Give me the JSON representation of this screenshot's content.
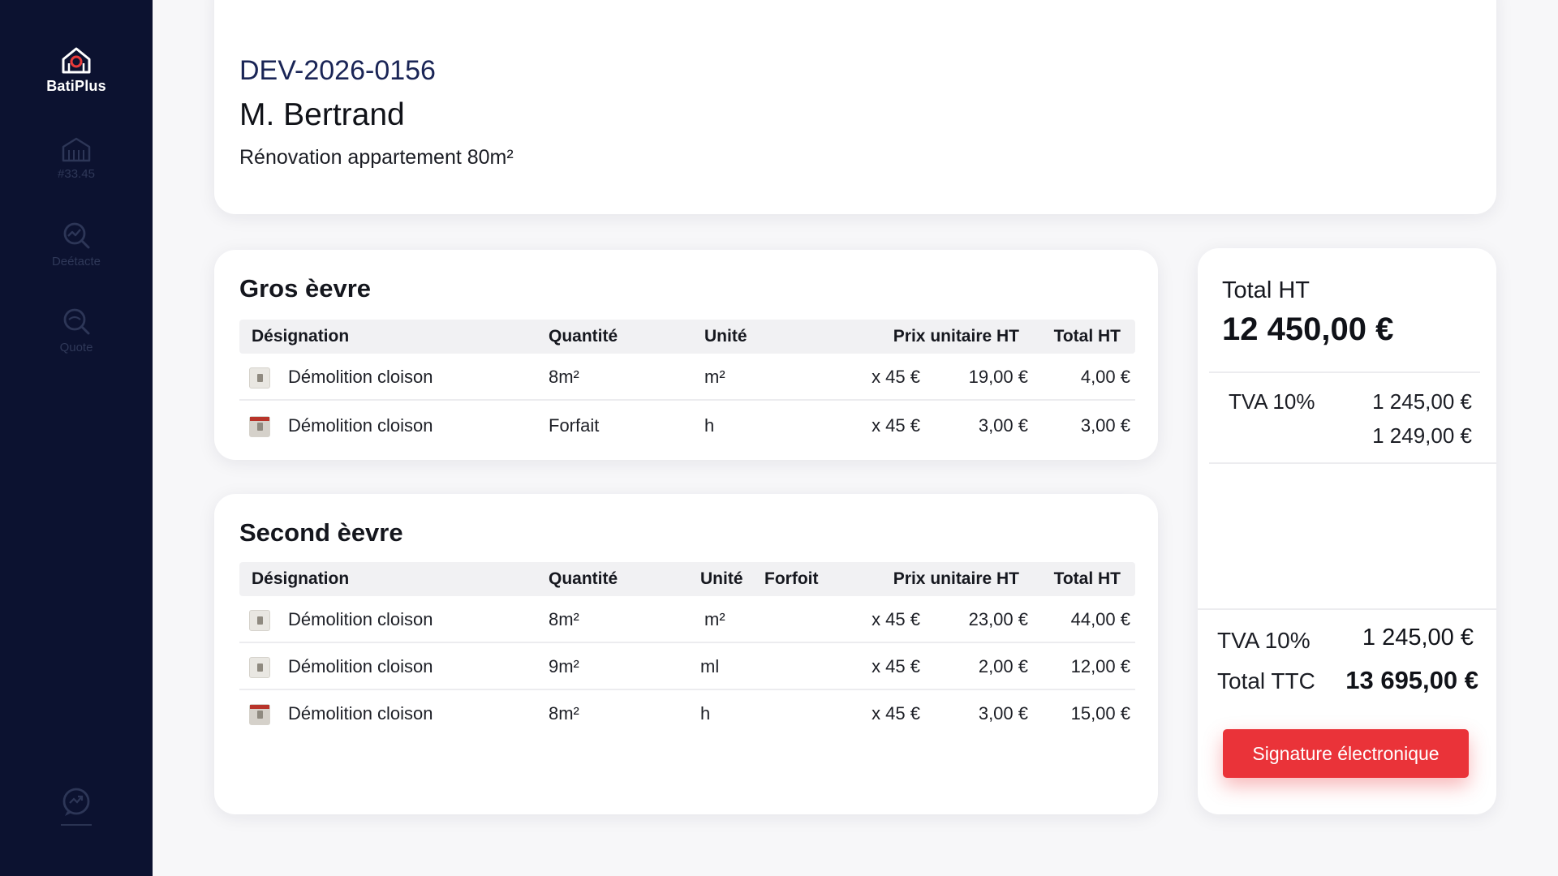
{
  "app": {
    "name": "BatiPlus",
    "colors": {
      "sidebar": "#0c1230",
      "accent": "#ea3339",
      "quote_number": "#1a2556"
    }
  },
  "sidebar": {
    "items": [
      {
        "icon": "building-icon",
        "label": "#33.45"
      },
      {
        "icon": "search-chart-icon",
        "label": "Deétacte"
      },
      {
        "icon": "search-icon",
        "label": "Quote"
      }
    ],
    "bottom_icon": "chat-add-icon"
  },
  "header": {
    "quote_number": "DEV-2026-0156",
    "client": "M. Bertrand",
    "project": "Rénovation appartement 80m²"
  },
  "sections": [
    {
      "title": "Gros èevre",
      "columns": [
        "Désignation",
        "Quantité",
        "Unité",
        "Prix unitaire HT",
        "Total HT"
      ],
      "rows": [
        {
          "designation": "Démolition cloison",
          "quantity": "8m²",
          "unit": "m²",
          "rate": "x 45 €",
          "unit_price": "19,00 €",
          "total": "4,00 €"
        },
        {
          "designation": "Démolition cloison",
          "quantity": "Forfait",
          "unit": "h",
          "rate": "x 45 €",
          "unit_price": "3,00 €",
          "total": "3,00 €"
        }
      ]
    },
    {
      "title": "Second èevre",
      "columns": [
        "Désignation",
        "Quantité",
        "Unité",
        "Forfoit",
        "Prix unitaire HT",
        "Total HT"
      ],
      "rows": [
        {
          "designation": "Démolition cloison",
          "quantity": "8m²",
          "unit": "m²",
          "rate": "x 45 €",
          "unit_price": "23,00 €",
          "total": "44,00 €"
        },
        {
          "designation": "Démolition cloison",
          "quantity": "9m²",
          "unit": "ml",
          "rate": "x 45 €",
          "unit_price": "2,00 €",
          "total": "12,00 €"
        },
        {
          "designation": "Démolition cloison",
          "quantity": "8m²",
          "unit": "h",
          "rate": "x 45 €",
          "unit_price": "3,00 €",
          "total": "15,00 €"
        }
      ]
    }
  ],
  "totals": {
    "total_ht_label": "Total HT",
    "total_ht": "12 450,00 €",
    "tva_label": "TVA 10%",
    "tva_values": [
      "1 245,00 €",
      "1 249,00 €"
    ],
    "tva_bottom_label": "TVA 10%",
    "tva_bottom": "1 245,00 €",
    "ttc_label": "Total TTC",
    "ttc": "13 695,00 €"
  },
  "actions": {
    "sign_label": "Signature électronique"
  }
}
